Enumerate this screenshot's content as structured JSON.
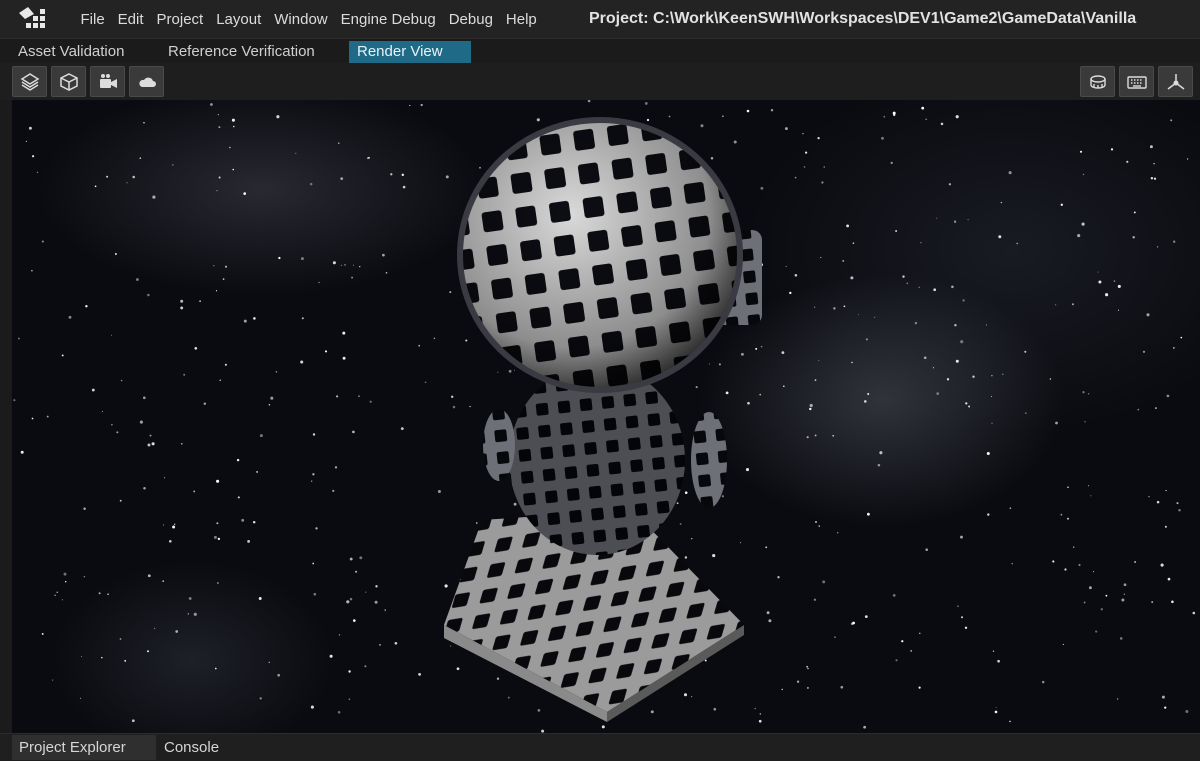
{
  "menu": {
    "items": [
      {
        "label": "File"
      },
      {
        "label": "Edit"
      },
      {
        "label": "Project"
      },
      {
        "label": "Layout"
      },
      {
        "label": "Window"
      },
      {
        "label": "Engine Debug"
      },
      {
        "label": "Debug"
      },
      {
        "label": "Help"
      }
    ]
  },
  "project_path": "Project: C:\\Work\\KeenSWH\\Workspaces\\DEV1\\Game2\\GameData\\Vanilla",
  "doc_tabs": {
    "items": [
      {
        "label": "Asset Validation"
      },
      {
        "label": "Reference Verification"
      },
      {
        "label": "Render View",
        "active": true
      }
    ]
  },
  "toolbar": {
    "left_icons": [
      "layers-icon",
      "cube-icon",
      "camera-video-icon",
      "cloud-icon"
    ],
    "right_icons": [
      "ruler-icon",
      "keyboard-icon",
      "axes-gizmo-icon"
    ]
  },
  "viewport": {
    "content": "3D render of a wire-frame lattice astronaut-like figure on a pedestal against a starfield",
    "accent_color": "#1f6a86"
  },
  "bottom_tabs": {
    "items": [
      {
        "label": "Project Explorer",
        "active": true
      },
      {
        "label": "Console"
      }
    ]
  }
}
